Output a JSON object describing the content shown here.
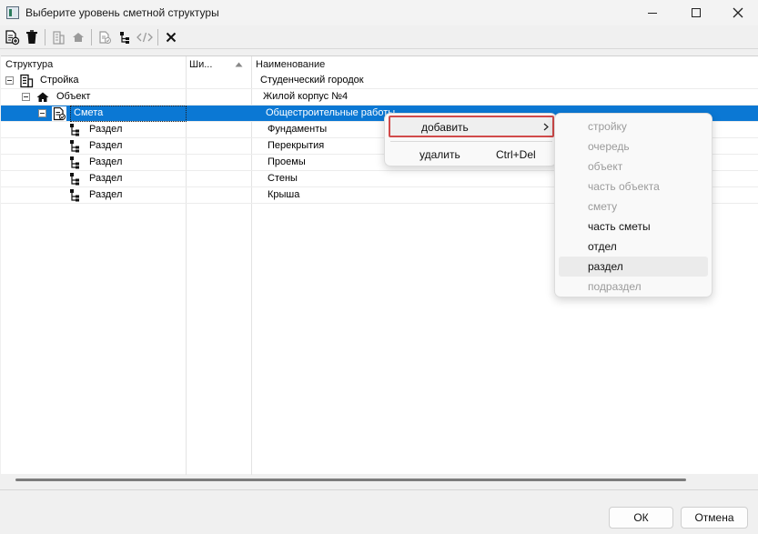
{
  "window": {
    "title": "Выберите уровень сметной структуры"
  },
  "toolbar": {
    "buttons": [
      "add-doc-icon",
      "delete-icon",
      "building-icon",
      "house-icon",
      "estimate-icon",
      "tree-icon",
      "code-icon",
      "close-icon"
    ]
  },
  "tree": {
    "headers": {
      "structure": "Структура",
      "width": "Ши...",
      "name": "Наименование"
    },
    "rows": [
      {
        "label": "Стройка",
        "name": "Студенческий городок",
        "icon": "building-icon"
      },
      {
        "label": "Объект",
        "name": "Жилой корпус №4",
        "icon": "house-icon"
      },
      {
        "label": "Смета",
        "name": "Общестроительные работы",
        "icon": "estimate-icon"
      },
      {
        "label": "Раздел",
        "name": "Фундаменты",
        "icon": "section-icon"
      },
      {
        "label": "Раздел",
        "name": "Перекрытия",
        "icon": "section-icon"
      },
      {
        "label": "Раздел",
        "name": "Проемы",
        "icon": "section-icon"
      },
      {
        "label": "Раздел",
        "name": "Стены",
        "icon": "section-icon"
      },
      {
        "label": "Раздел",
        "name": "Крыша",
        "icon": "section-icon"
      }
    ]
  },
  "context_menu": {
    "add_label": "добавить",
    "delete_label": "удалить",
    "delete_shortcut": "Ctrl+Del"
  },
  "submenu": {
    "items": [
      {
        "label": "стройку",
        "enabled": false
      },
      {
        "label": "очередь",
        "enabled": false
      },
      {
        "label": "объект",
        "enabled": false
      },
      {
        "label": "часть объекта",
        "enabled": false
      },
      {
        "label": "смету",
        "enabled": false
      },
      {
        "label": "часть сметы",
        "enabled": true
      },
      {
        "label": "отдел",
        "enabled": true
      },
      {
        "label": "раздел",
        "enabled": true
      },
      {
        "label": "подраздел",
        "enabled": false
      }
    ]
  },
  "footer": {
    "ok_label": "ОК",
    "cancel_label": "Отмена"
  },
  "colors": {
    "selection": "#0b78d4",
    "highlight_border": "#d14a4a"
  }
}
